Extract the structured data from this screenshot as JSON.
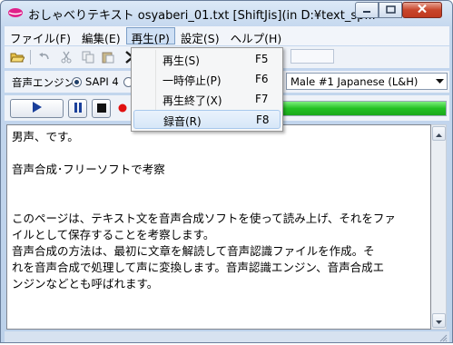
{
  "window": {
    "title": "おしゃべりテキスト osyaberi_01.txt [ShiftJis](in D:¥text_sp..."
  },
  "menubar": {
    "items": [
      {
        "label": "ファイル(F)"
      },
      {
        "label": "編集(E)"
      },
      {
        "label": "再生(P)"
      },
      {
        "label": "設定(S)"
      },
      {
        "label": "ヘルプ(H)"
      }
    ],
    "active_index": 2
  },
  "toolbar": {
    "icons": [
      "open-folder-icon",
      "undo-icon",
      "cut-icon",
      "copy-icon",
      "paste-icon",
      "arrow-icon"
    ]
  },
  "engine": {
    "label": "音声エンジン",
    "option_selected": "SAPI 4",
    "voice_value": "Male #1 Japanese (L&H)"
  },
  "player": {
    "buttons": [
      "play-icon",
      "pause-icon",
      "stop-icon",
      "record-icon"
    ],
    "progress": 1.0,
    "progress_color": "#23c023"
  },
  "playback_menu": {
    "items": [
      {
        "label": "再生(S)",
        "shortcut": "F5"
      },
      {
        "label": "一時停止(P)",
        "shortcut": "F6"
      },
      {
        "label": "再生終了(X)",
        "shortcut": "F7"
      },
      {
        "label": "録音(R)",
        "shortcut": "F8"
      }
    ],
    "highlighted_index": 3
  },
  "editor": {
    "lines": [
      "男声、です。",
      "",
      "音声合成･フリーソフトで考察",
      "",
      "",
      "このページは、テキスト文を音声合成ソフトを使って読み上げ、それをファ",
      "イルとして保存することを考察します。",
      "音声合成の方法は、最初に文章を解読して音声認識ファイルを作成。そ",
      "れを音声合成で処理して声に変換します。音声認識エンジン、音声合成エ",
      "ンジンなどとも呼ばれます。"
    ]
  }
}
